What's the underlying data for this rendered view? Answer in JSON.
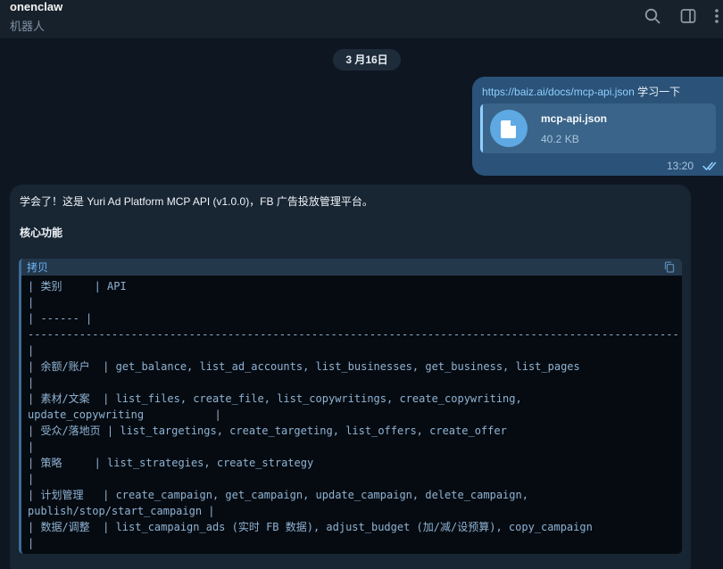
{
  "header": {
    "title": "onenclaw",
    "subtitle": "机器人",
    "icons": [
      "search-icon",
      "sidebar-toggle-icon",
      "more-icon"
    ]
  },
  "date_chip": "3 月16日",
  "outgoing": {
    "link": "https://baiz.ai/docs/mcp-api.json",
    "text": " 学习一下",
    "file": {
      "name": "mcp-api.json",
      "size": "40.2 KB",
      "icon": "file-icon"
    },
    "time": "13:20",
    "status_icon": "double-check-icon"
  },
  "incoming": {
    "line1": "学会了！这是 Yuri Ad Platform MCP API (v1.0.0)，FB 广告投放管理平台。",
    "line2": "核心功能",
    "code": {
      "lang": "拷贝",
      "copy_icon": "copy-icon",
      "lines": [
        "| 类别     | API",
        "|",
        "| ------ |",
        "-----------------------------------------------------------------------------------------------------",
        "|",
        "| 余额/账户  | get_balance, list_ad_accounts, list_businesses, get_business, list_pages",
        "|",
        "| 素材/文案  | list_files, create_file, list_copywritings, create_copywriting,",
        "update_copywriting           |",
        "| 受众/落地页 | list_targetings, create_targeting, list_offers, create_offer",
        "|",
        "| 策略     | list_strategies, create_strategy",
        "|",
        "| 计划管理   | create_campaign, get_campaign, update_campaign, delete_campaign,",
        "publish/stop/start_campaign |",
        "| 数据/调整  | list_campaign_ads (实时 FB 数据), adjust_budget (加/减/设预算), copy_campaign",
        "|"
      ]
    }
  }
}
